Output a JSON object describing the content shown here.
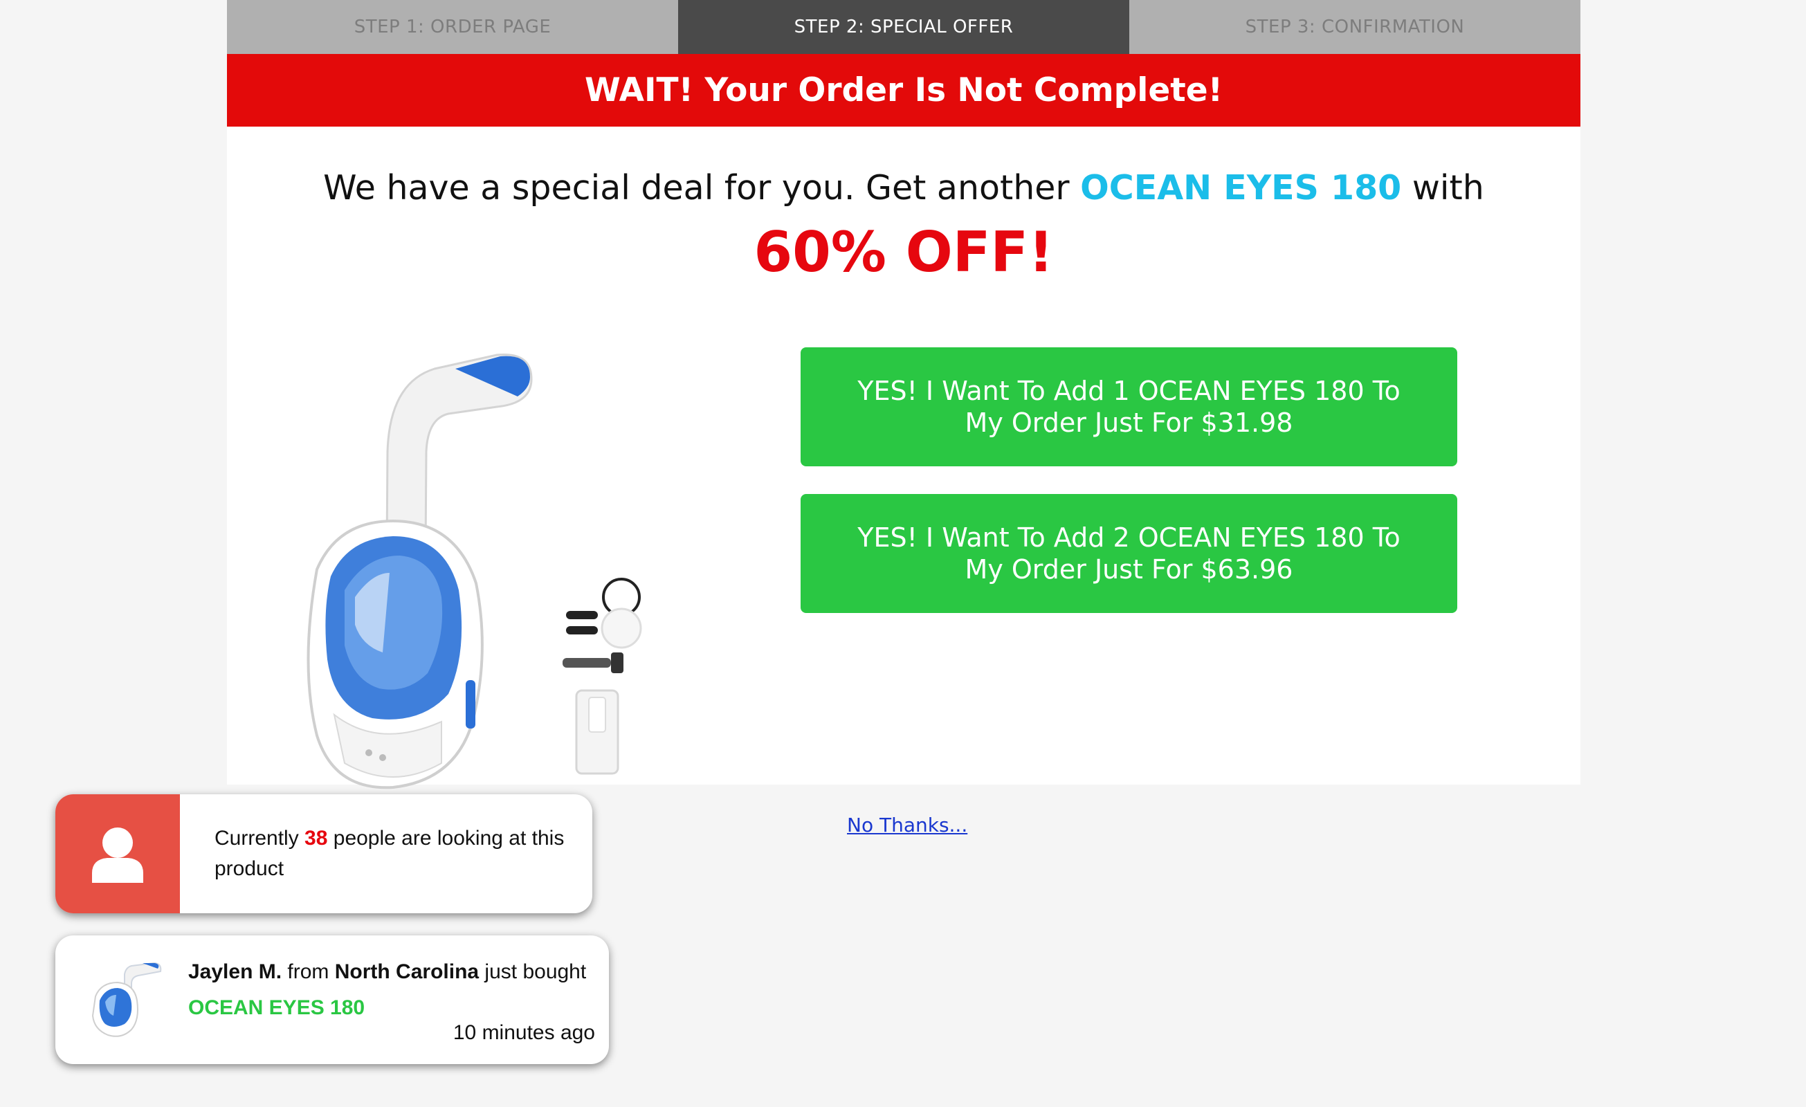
{
  "steps": [
    {
      "label": "STEP 1: ORDER PAGE"
    },
    {
      "label": "STEP 2: SPECIAL OFFER"
    },
    {
      "label": "STEP 3: CONFIRMATION"
    }
  ],
  "alert": "WAIT! Your Order Is Not Complete!",
  "offer": {
    "headline_prefix": "We have a special deal for you. Get another ",
    "brand": "OCEAN EYES 180",
    "headline_suffix": " with",
    "discount": "60% OFF!"
  },
  "cta": {
    "one": "YES! I Want To Add 1 OCEAN EYES 180 To My Order Just For $31.98",
    "two": "YES! I Want To Add 2 OCEAN EYES 180 To My Order Just For $63.96"
  },
  "no_thanks": "No Thanks...",
  "watch_popup": {
    "prefix": "Currently ",
    "count": "38",
    "suffix": " people are looking at this product"
  },
  "buy_popup": {
    "name": "Jaylen M.",
    "from": " from ",
    "location": "North Carolina",
    "action": " just bought",
    "product": "OCEAN EYES 180",
    "time": "10 minutes ago"
  },
  "colors": {
    "alert_red": "#e30a0a",
    "brand_blue": "#1bbde9",
    "discount_red": "#e6070f",
    "cta_green": "#2ac743",
    "link_blue": "#1a38cf"
  }
}
